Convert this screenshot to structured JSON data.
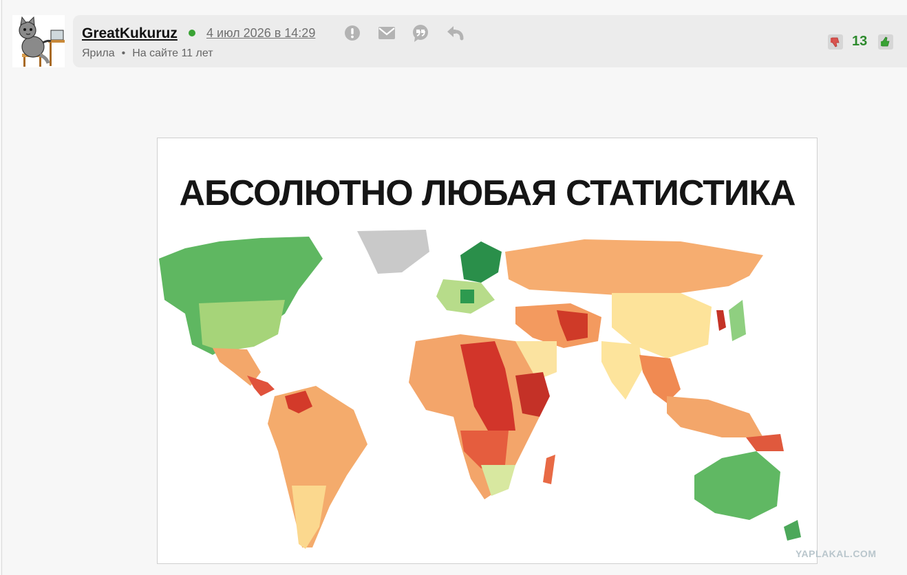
{
  "post": {
    "username": "GreatKukuruz",
    "date": "4 июл 2026 в 14:29",
    "rank": "Ярила",
    "bullet": "•",
    "member_since": "На сайте 11 лет",
    "score": "13"
  },
  "image": {
    "title": "АБСОЛЮТНО ЛЮБАЯ СТАТИСТИКА"
  },
  "watermark": "YAPLAKAL.COM",
  "icons": {
    "report": "exclamation-circle-icon",
    "message": "envelope-icon",
    "quote": "quote-icon",
    "reply": "reply-arrow-icon",
    "vote_down": "thumbs-down-icon",
    "vote_up": "thumbs-up-icon"
  },
  "colors": {
    "score": "#2d8a2d",
    "online": "#3aa335",
    "vote_down": "#d9534f",
    "vote_up": "#3aa335"
  }
}
